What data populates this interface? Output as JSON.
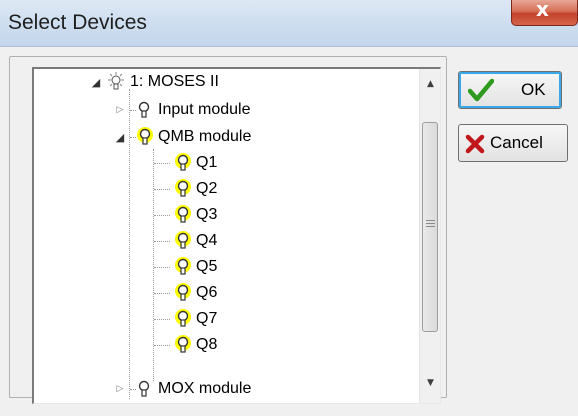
{
  "window": {
    "title": "Select Devices",
    "close_symbol": "x"
  },
  "tree": {
    "root": {
      "label": "1: MOSES II",
      "icon": "device-bulb-icon",
      "expanded": true
    },
    "children": [
      {
        "label": "Input module",
        "icon": "bulb-off-icon",
        "expanded": false
      },
      {
        "label": "QMB module",
        "icon": "bulb-on-icon",
        "expanded": true,
        "children": [
          "Q1",
          "Q2",
          "Q3",
          "Q4",
          "Q5",
          "Q6",
          "Q7",
          "Q8"
        ]
      },
      {
        "label": "MOX module",
        "icon": "bulb-off-icon",
        "expanded": false
      }
    ]
  },
  "buttons": {
    "ok_label": "OK",
    "cancel_label": "Cancel"
  },
  "colors": {
    "titlebar": "#cfdff0",
    "close_button": "#c7472d",
    "bulb_on_glow": "#ffff00",
    "ok_check": "#2e9b1e",
    "cancel_x": "#c0181a"
  }
}
